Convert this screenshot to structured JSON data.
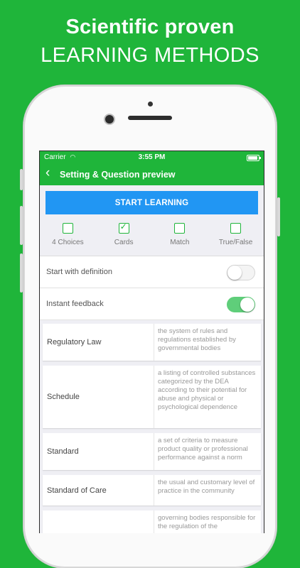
{
  "headline": {
    "line1": "Scientific proven",
    "line2": "LEARNING METHODS"
  },
  "status_bar": {
    "carrier": "Carrier",
    "wifi": "wifi-icon",
    "time": "3:55 PM"
  },
  "nav": {
    "back_icon": "chevron-left-icon",
    "title": "Setting & Question preview"
  },
  "start_button": "START LEARNING",
  "modes": [
    {
      "label": "4 Choices",
      "checked": false
    },
    {
      "label": "Cards",
      "checked": true
    },
    {
      "label": "Match",
      "checked": false
    },
    {
      "label": "True/False",
      "checked": false
    }
  ],
  "settings": [
    {
      "label": "Start with definition",
      "on": false
    },
    {
      "label": "Instant feedback",
      "on": true
    }
  ],
  "terms": [
    {
      "term": "Regulatory Law",
      "definition": "the system of rules and regulations established by governmental bodies"
    },
    {
      "term": "Schedule",
      "definition": "a listing of controlled substances categorized by the DEA according to their potential for abuse and physical or psychological dependence"
    },
    {
      "term": "Standard",
      "definition": "a set of criteria to measure product quality or professional performance against a norm"
    },
    {
      "term": "Standard of Care",
      "definition": "the usual and customary level of practice in the community"
    },
    {
      "term": "",
      "definition": "governing bodies responsible for the regulation of the"
    }
  ],
  "colors": {
    "brand_green": "#1fb53a",
    "button_blue": "#2196f3"
  }
}
